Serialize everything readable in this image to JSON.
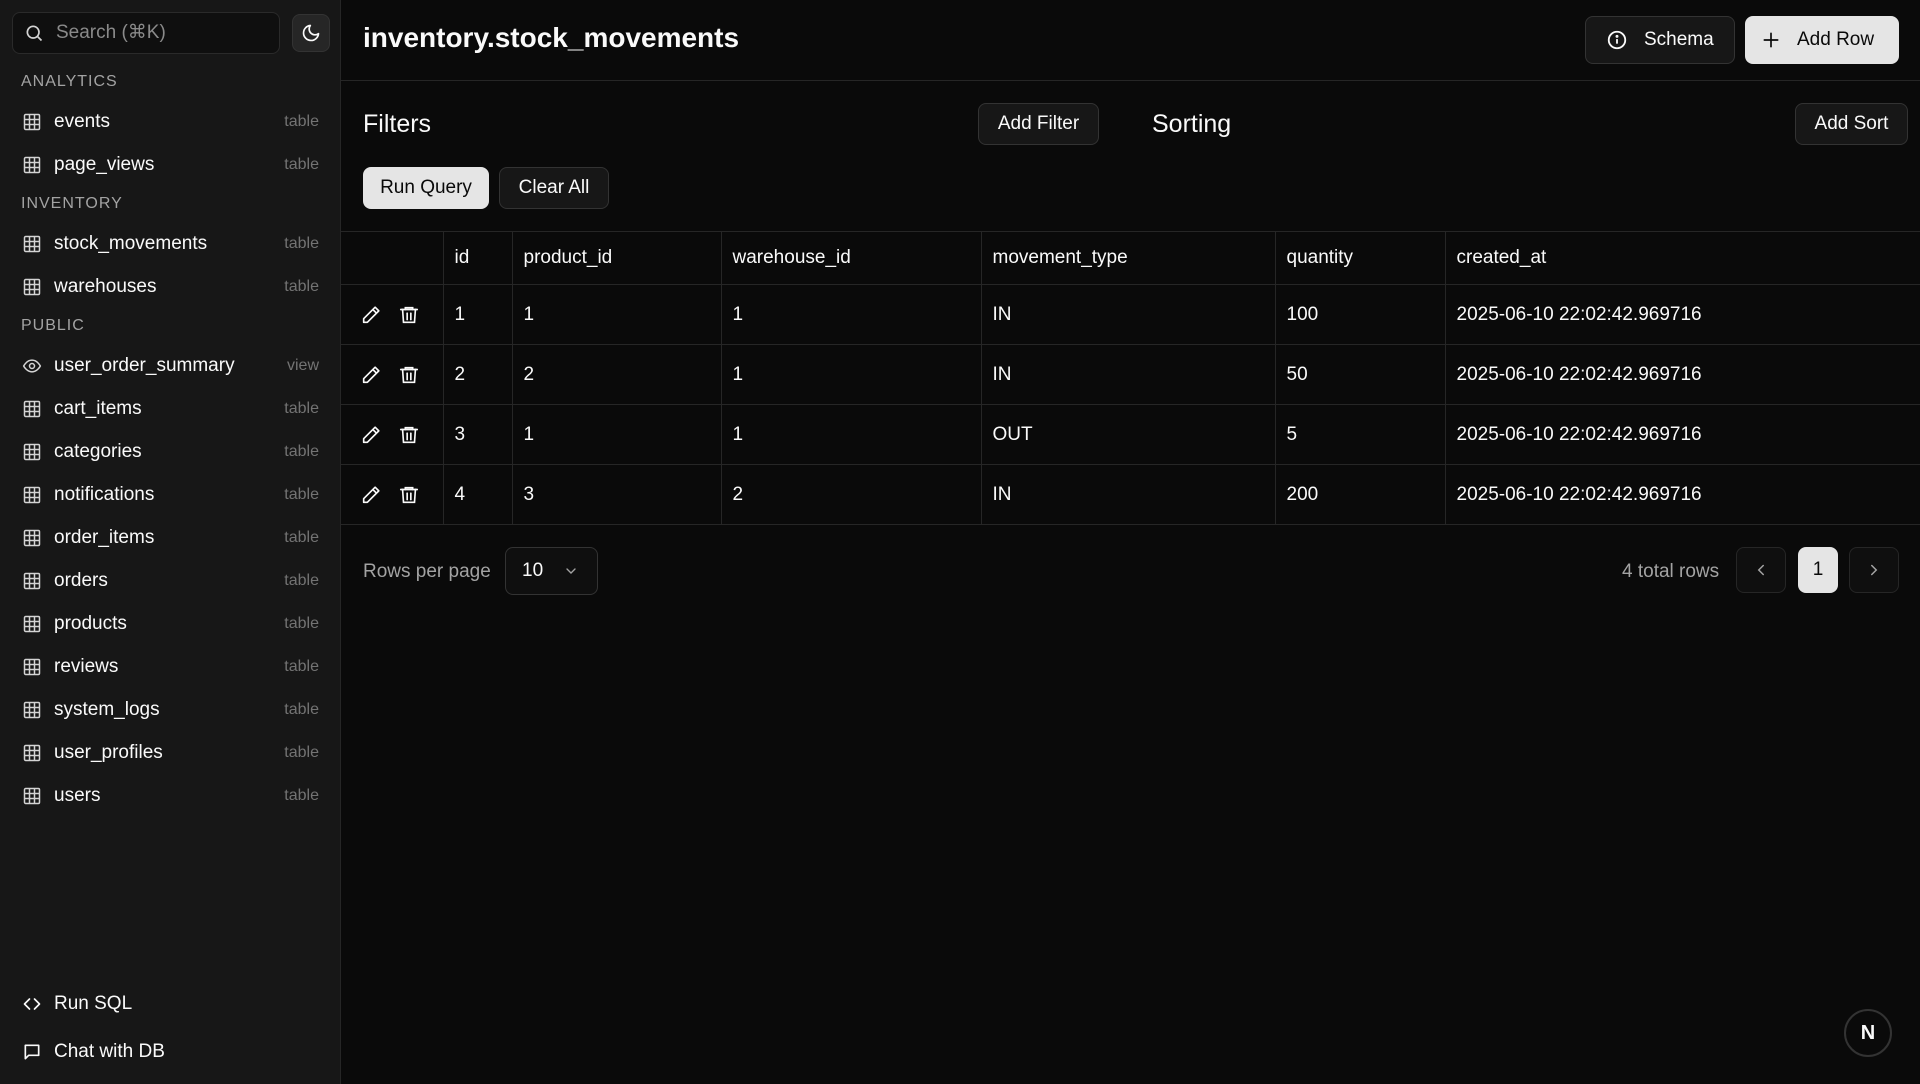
{
  "sidebar": {
    "search": {
      "placeholder": "Search (⌘K)"
    },
    "sections": [
      {
        "title": "ANALYTICS",
        "items": [
          {
            "label": "events",
            "kind": "table",
            "icon": "table-icon"
          },
          {
            "label": "page_views",
            "kind": "table",
            "icon": "table-icon"
          }
        ]
      },
      {
        "title": "INVENTORY",
        "items": [
          {
            "label": "stock_movements",
            "kind": "table",
            "icon": "table-icon"
          },
          {
            "label": "warehouses",
            "kind": "table",
            "icon": "table-icon"
          }
        ]
      },
      {
        "title": "PUBLIC",
        "items": [
          {
            "label": "user_order_summary",
            "kind": "view",
            "icon": "eye-icon"
          },
          {
            "label": "cart_items",
            "kind": "table",
            "icon": "table-icon"
          },
          {
            "label": "categories",
            "kind": "table",
            "icon": "table-icon"
          },
          {
            "label": "notifications",
            "kind": "table",
            "icon": "table-icon"
          },
          {
            "label": "order_items",
            "kind": "table",
            "icon": "table-icon"
          },
          {
            "label": "orders",
            "kind": "table",
            "icon": "table-icon"
          },
          {
            "label": "products",
            "kind": "table",
            "icon": "table-icon"
          },
          {
            "label": "reviews",
            "kind": "table",
            "icon": "table-icon"
          },
          {
            "label": "system_logs",
            "kind": "table",
            "icon": "table-icon"
          },
          {
            "label": "user_profiles",
            "kind": "table",
            "icon": "table-icon"
          },
          {
            "label": "users",
            "kind": "table",
            "icon": "table-icon"
          }
        ]
      }
    ],
    "bottom": {
      "run_sql": "Run SQL",
      "chat": "Chat with DB"
    }
  },
  "header": {
    "title": "inventory.stock_movements",
    "schema_label": "Schema",
    "add_row_label": "Add Row"
  },
  "query": {
    "filters_title": "Filters",
    "add_filter_label": "Add Filter",
    "sorting_title": "Sorting",
    "add_sort_label": "Add Sort",
    "run_label": "Run Query",
    "clear_label": "Clear All"
  },
  "table": {
    "columns": [
      "id",
      "product_id",
      "warehouse_id",
      "movement_type",
      "quantity",
      "created_at"
    ],
    "rows": [
      [
        "1",
        "1",
        "1",
        "IN",
        "100",
        "2025-06-10 22:02:42.969716"
      ],
      [
        "2",
        "2",
        "1",
        "IN",
        "50",
        "2025-06-10 22:02:42.969716"
      ],
      [
        "3",
        "1",
        "1",
        "OUT",
        "5",
        "2025-06-10 22:02:42.969716"
      ],
      [
        "4",
        "3",
        "2",
        "IN",
        "200",
        "2025-06-10 22:02:42.969716"
      ]
    ]
  },
  "pagination": {
    "rows_per_page_label": "Rows per page",
    "page_size": "10",
    "total_label": "4 total rows",
    "current_page": "1"
  },
  "fab": {
    "label": "N"
  },
  "colors": {
    "background": "#0a0a0a",
    "sidebar": "#171717",
    "primary_button": "#e5e5e5",
    "border": "#262626"
  }
}
